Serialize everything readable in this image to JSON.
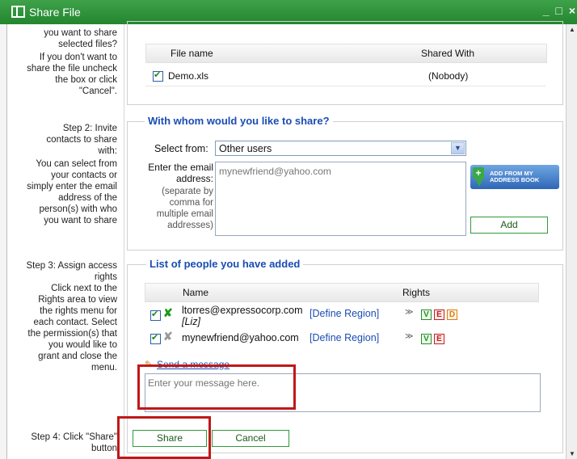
{
  "window": {
    "title": "Share File",
    "controls": "_ □ ×"
  },
  "sidebar": {
    "step1_partial": [
      "you want to share",
      "selected files?"
    ],
    "step1_desc": [
      "If you don't want to",
      "share the file uncheck",
      "the box or click",
      "\"Cancel\"."
    ],
    "step2_title": [
      "Step 2: Invite",
      "contacts to share",
      "with:"
    ],
    "step2_desc": [
      "You can select from",
      "your contacts or",
      "simply enter the email",
      "address of the",
      "person(s) with who",
      "you want to share"
    ],
    "step3_title": [
      "Step 3: Assign access",
      "rights"
    ],
    "step3_desc": [
      "Click next to the",
      "Rights area to view",
      "the rights menu for",
      "each contact. Select",
      "the permission(s) that",
      "you would like to",
      "grant and close the",
      "menu."
    ],
    "step4_title": [
      "Step 4: Click \"Share\"",
      "button"
    ]
  },
  "files_table": {
    "headers": {
      "name": "File name",
      "shared": "Shared With"
    },
    "rows": [
      {
        "name": "Demo.xls",
        "shared": "(Nobody)"
      }
    ]
  },
  "share_section": {
    "title": "With whom would you like to share?",
    "select_label": "Select from:",
    "select_value": "Other users",
    "email_label": [
      "Enter the email",
      "address:"
    ],
    "email_hint": [
      "(separate by",
      "comma for",
      "multiple email",
      "addresses)"
    ],
    "email_value": "mynewfriend@yahoo.com",
    "address_book_label": [
      "ADD FROM MY",
      "ADDRESS BOOK"
    ],
    "add_button": "Add"
  },
  "people_section": {
    "title": "List of people you have added",
    "headers": {
      "name": "Name",
      "rights": "Rights"
    },
    "rows": [
      {
        "email": "ltorres@expressocorp.com",
        "alias": "[Liz]",
        "region": "[Define Region]",
        "rights": [
          "V",
          "E",
          "D"
        ]
      },
      {
        "email": "mynewfriend@yahoo.com",
        "alias": "",
        "region": "[Define Region]",
        "rights": [
          "V",
          "E"
        ]
      }
    ]
  },
  "message": {
    "link": "Send a message",
    "placeholder": "Enter your message here."
  },
  "buttons": {
    "share": "Share",
    "cancel": "Cancel"
  },
  "colors": {
    "titlebar": "#2e9a3c",
    "accent_blue": "#1a4db3",
    "highlight_red": "#c01818"
  }
}
